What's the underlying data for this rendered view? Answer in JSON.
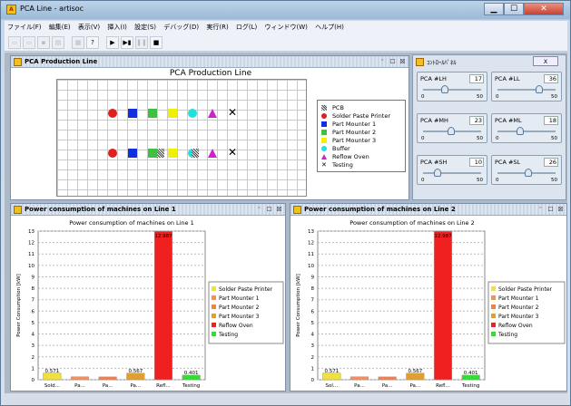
{
  "window": {
    "title": "PCA Line - artisoc",
    "app_icon": "A"
  },
  "menu": [
    "ファイル(F)",
    "編集(E)",
    "表示(V)",
    "挿入(I)",
    "設定(S)",
    "デバッグ(D)",
    "実行(R)",
    "ログ(L)",
    "ウィンドウ(W)",
    "ヘルプ(H)"
  ],
  "toolbar": {
    "help_label": "?"
  },
  "production": {
    "window_title": "PCA Production Line",
    "chart_title": "PCA Production Line",
    "legend": [
      {
        "label": "PCB",
        "color": "#404040",
        "icon": "pcb-icon"
      },
      {
        "label": "Solder Paste Printer",
        "color": "#e02020",
        "icon": "circle-icon"
      },
      {
        "label": "Part Mounter 1",
        "color": "#1030e0",
        "icon": "square-icon"
      },
      {
        "label": "Part Mounter 2",
        "color": "#40c040",
        "icon": "square-icon"
      },
      {
        "label": "Part Mounter 3",
        "color": "#f0f000",
        "icon": "square-icon"
      },
      {
        "label": "Buffer",
        "color": "#20e0e0",
        "icon": "circle-icon"
      },
      {
        "label": "Reflow Oven",
        "color": "#d020d0",
        "icon": "triangle-icon"
      },
      {
        "label": "Testing",
        "color": "#000000",
        "icon": "x-icon"
      }
    ]
  },
  "control_panel": {
    "title": "ｺﾝﾄﾛｰﾙﾊﾟﾈﾙ",
    "close_label": "X",
    "sliders": [
      {
        "label": "PCA #LH",
        "value": "17",
        "min": "0",
        "max": "50",
        "ratio": 0.34
      },
      {
        "label": "PCA #LL",
        "value": "36",
        "min": "0",
        "max": "50",
        "ratio": 0.72
      },
      {
        "label": "PCA #MH",
        "value": "23",
        "min": "0",
        "max": "50",
        "ratio": 0.46
      },
      {
        "label": "PCA #ML",
        "value": "18",
        "min": "0",
        "max": "50",
        "ratio": 0.36
      },
      {
        "label": "PCA #SH",
        "value": "10",
        "min": "0",
        "max": "50",
        "ratio": 0.2
      },
      {
        "label": "PCA #SL",
        "value": "26",
        "min": "0",
        "max": "50",
        "ratio": 0.52
      }
    ]
  },
  "power1": {
    "window_title": "Power consumption of machines on Line 1"
  },
  "power2": {
    "window_title": "Power consumption of machines on Line 2"
  },
  "chart_data": [
    {
      "type": "bar",
      "title": "Power consumption of machines on Line 1",
      "xlabel": "",
      "ylabel": "Power Consumption [kW]",
      "ylim": [
        0,
        13
      ],
      "categories": [
        "Sold...",
        "Pa...",
        "Pa...",
        "Pa...",
        "Refl...",
        "Testing"
      ],
      "values": [
        0.571,
        0.26,
        0.25,
        0.567,
        12.987,
        0.4
      ],
      "data_labels": [
        "0.571",
        "",
        "",
        "0.567",
        "12.987",
        "0.401"
      ],
      "colors": [
        "#f0e040",
        "#f09060",
        "#f08050",
        "#e0a030",
        "#f02020",
        "#30e030"
      ],
      "legend": [
        "Solder Paste Printer",
        "Part Mounter 1",
        "Part Mounter 2",
        "Part Mounter 3",
        "Reflow Oven",
        "Testing"
      ],
      "legend_position": "right",
      "grid": true
    },
    {
      "type": "bar",
      "title": "Power consumption of machines on Line 2",
      "xlabel": "",
      "ylabel": "Power Consumption [kW]",
      "ylim": [
        0,
        13
      ],
      "categories": [
        "Sol...",
        "Pa...",
        "Pa...",
        "Pa...",
        "Refl...",
        "Testing"
      ],
      "values": [
        0.571,
        0.26,
        0.25,
        0.567,
        12.987,
        0.4
      ],
      "data_labels": [
        "0.571",
        "",
        "",
        "0.567",
        "12.987",
        "0.401"
      ],
      "colors": [
        "#f0e040",
        "#f09060",
        "#f08050",
        "#e0a030",
        "#f02020",
        "#30e030"
      ],
      "legend": [
        "Solder Paste Printer",
        "Part Mounter 1",
        "Part Mounter 2",
        "Part Mounter 3",
        "Reflow Oven",
        "Testing"
      ],
      "legend_position": "right",
      "grid": true
    }
  ]
}
